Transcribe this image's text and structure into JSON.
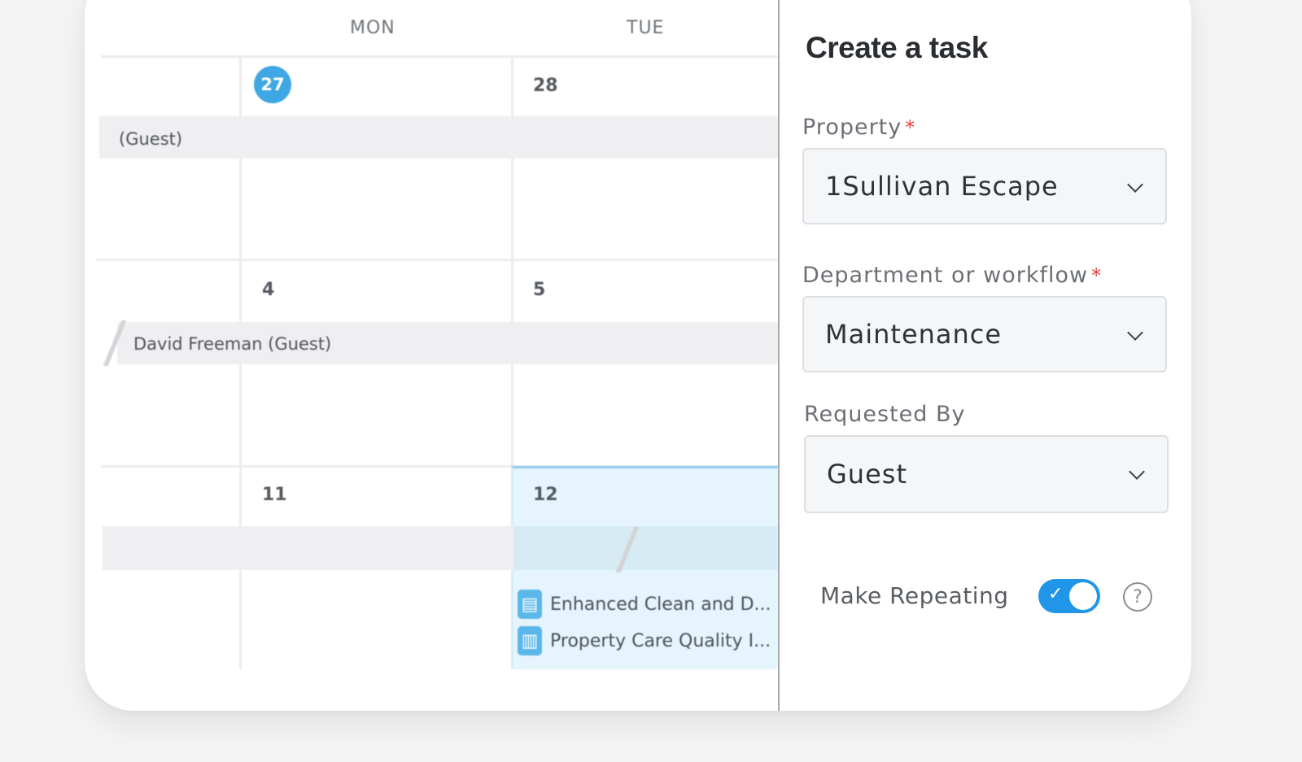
{
  "calendar": {
    "day_headers": [
      "MON",
      "TUE"
    ],
    "weeks": [
      {
        "mon": "27",
        "tue": "28",
        "reservation": "(Guest)"
      },
      {
        "mon": "4",
        "tue": "5",
        "reservation": "David Freeman (Guest)"
      },
      {
        "mon": "11",
        "tue": "12",
        "reservation": ""
      }
    ],
    "tasks": [
      {
        "label": "Enhanced Clean and D...",
        "icon": "calendar-clean-icon"
      },
      {
        "label": "Property Care Quality I...",
        "icon": "clipboard-icon"
      }
    ]
  },
  "panel": {
    "title": "Create a task",
    "property": {
      "label": "Property",
      "required": "*",
      "value": "1Sullivan Escape"
    },
    "department": {
      "label": "Department or workflow",
      "required": "*",
      "value": "Maintenance"
    },
    "requested_by": {
      "label": "Requested By",
      "value": "Guest"
    },
    "repeating": {
      "label": "Make Repeating",
      "enabled": true,
      "check": "✓",
      "help": "?"
    }
  },
  "colors": {
    "accent": "#3fa7e3",
    "toggle": "#2196e8",
    "required": "#e3423a",
    "selected_cell": "#e6f5fd"
  }
}
